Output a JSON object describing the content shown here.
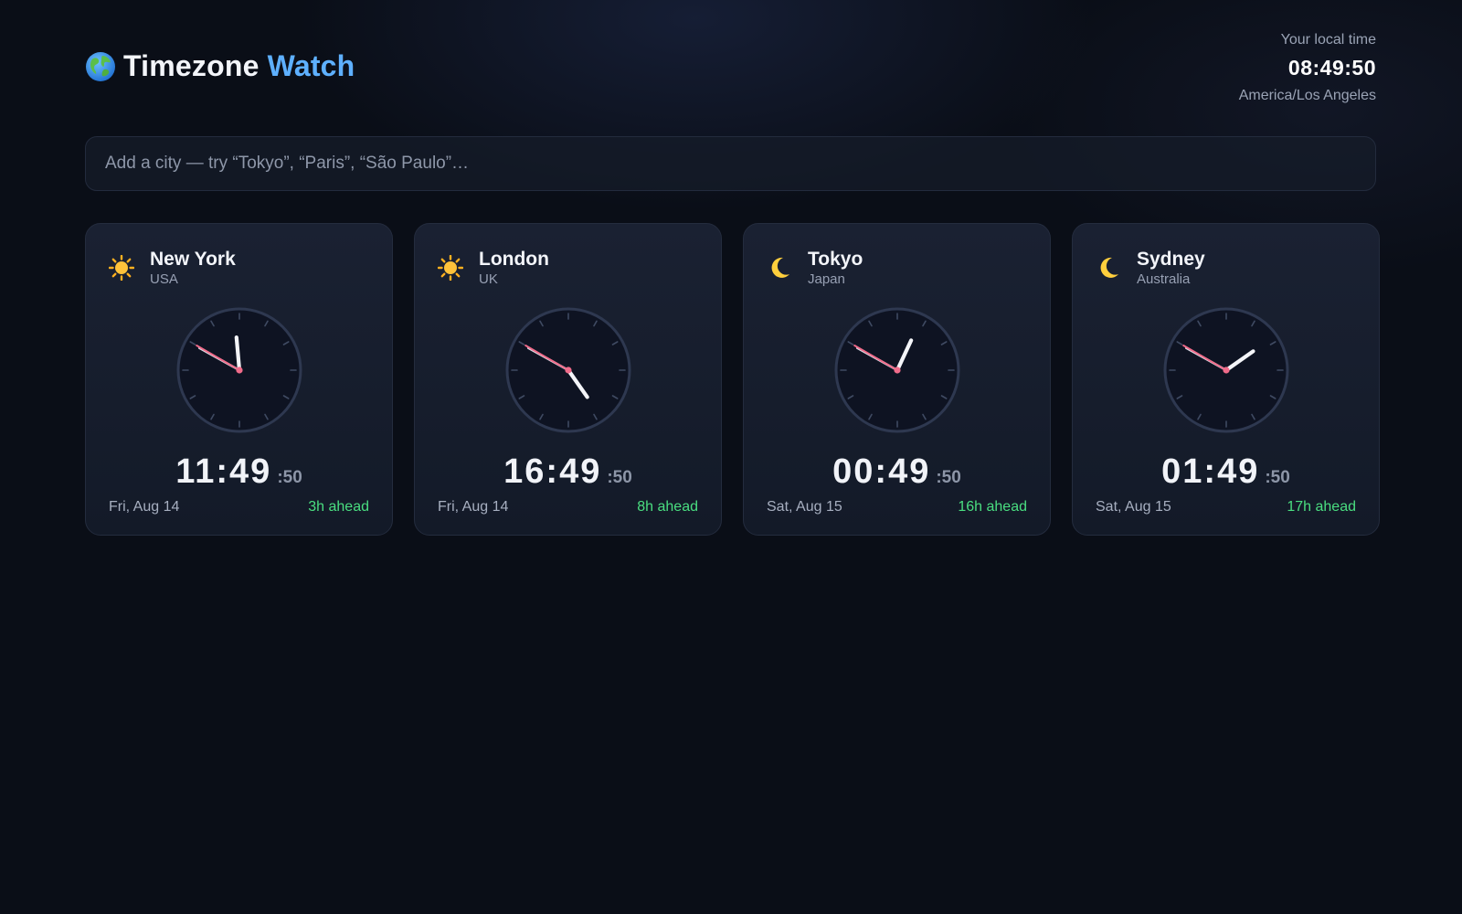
{
  "header": {
    "title_part1": "Timezone",
    "title_part2": "Watch",
    "logo_icon": "globe-icon"
  },
  "local": {
    "label": "Your local time",
    "time": "08:49:50",
    "timezone": "America/Los Angeles"
  },
  "search": {
    "placeholder": "Add a city — try “Tokyo”, “Paris”, “São Paulo”…",
    "value": ""
  },
  "colors": {
    "accent": "#5eb0ff",
    "offset_green": "#4ade80",
    "second_hand": "#f06b8a",
    "background": "#0a0e17"
  },
  "cities": [
    {
      "city": "New York",
      "country": "USA",
      "icon": "sun-icon",
      "time": "11:49",
      "seconds": ":50",
      "date": "Fri, Aug 14",
      "offset": "3h ahead",
      "hour": 11,
      "minute": 49,
      "second": 50
    },
    {
      "city": "London",
      "country": "UK",
      "icon": "sun-icon",
      "time": "16:49",
      "seconds": ":50",
      "date": "Fri, Aug 14",
      "offset": "8h ahead",
      "hour": 16,
      "minute": 49,
      "second": 50
    },
    {
      "city": "Tokyo",
      "country": "Japan",
      "icon": "moon-icon",
      "time": "00:49",
      "seconds": ":50",
      "date": "Sat, Aug 15",
      "offset": "16h ahead",
      "hour": 0,
      "minute": 49,
      "second": 50
    },
    {
      "city": "Sydney",
      "country": "Australia",
      "icon": "moon-icon",
      "time": "01:49",
      "seconds": ":50",
      "date": "Sat, Aug 15",
      "offset": "17h ahead",
      "hour": 1,
      "minute": 49,
      "second": 50
    }
  ]
}
